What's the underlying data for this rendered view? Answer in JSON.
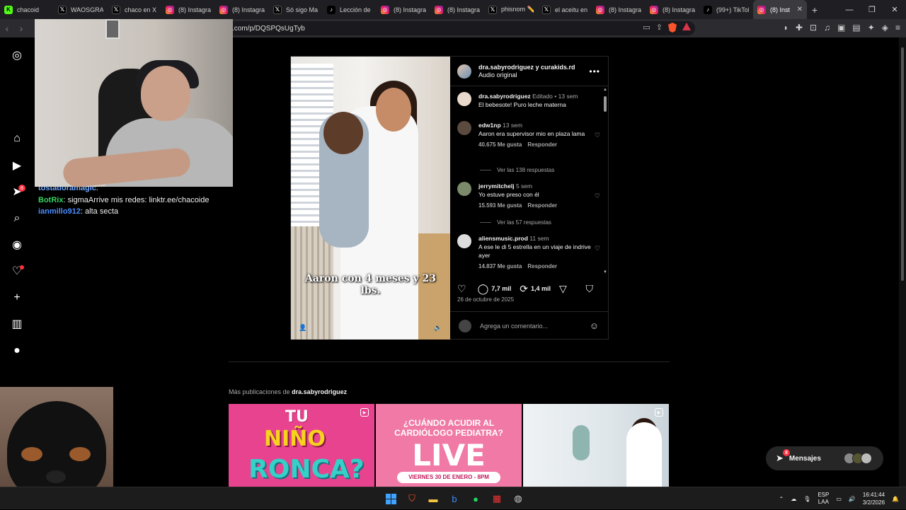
{
  "browser": {
    "tabs": [
      {
        "label": "chacoid",
        "icon": "kick-icon"
      },
      {
        "label": "WAOSGRAN",
        "icon": "x-icon"
      },
      {
        "label": "chaco en X",
        "icon": "x-icon"
      },
      {
        "label": "(8) Instagram",
        "icon": "instagram-icon"
      },
      {
        "label": "(8) Instagram",
        "icon": "instagram-icon"
      },
      {
        "label": "Só sigo Ma",
        "icon": "x-icon"
      },
      {
        "label": "Lección de",
        "icon": "tiktok-icon"
      },
      {
        "label": "(8) Instagram",
        "icon": "instagram-icon"
      },
      {
        "label": "(8) Instagram",
        "icon": "instagram-icon"
      },
      {
        "label": "phisnom ✏️",
        "icon": "x-icon"
      },
      {
        "label": "el aceitu en",
        "icon": "x-icon"
      },
      {
        "label": "(8) Instagram",
        "icon": "instagram-icon"
      },
      {
        "label": "(8) Instagram",
        "icon": "instagram-icon"
      },
      {
        "label": "(99+) TikTok",
        "icon": "tiktok-icon"
      }
    ],
    "active_tab": "(8) Inst",
    "url": ".com/p/DQSPQsUgTyb"
  },
  "chat": {
    "lines": [
      {
        "user": "tostadoramagic",
        "text": ""
      },
      {
        "user": "BotRix",
        "text": "sigmaArrive mis redes: linktr.ee/chacoide"
      },
      {
        "user": "ianmillo912",
        "text": "alta secta"
      }
    ]
  },
  "rail": {
    "notifications_badge": "8"
  },
  "post": {
    "header_names": "dra.sabyrodriguez y curakids.rd",
    "audio": "Audio original",
    "caption_overlay": "Aaron con 4 meses y 23 lbs.",
    "comments": [
      {
        "user": "dra.sabyrodriguez",
        "edited": "Editado",
        "time": "13 sem",
        "text": "El bebesote! Puro leche materna",
        "likes": "",
        "reply": ""
      },
      {
        "user": "edw1np",
        "time": "13 sem",
        "text": "Aaron era supervisor mio en plaza lama",
        "likes": "40.675 Me gusta",
        "reply": "Responder",
        "replies": "Ver las 138 respuestas"
      },
      {
        "user": "jerrymitchelj",
        "time": "5 sem",
        "text": "Yo estuve preso con él",
        "likes": "15.593 Me gusta",
        "reply": "Responder",
        "replies": "Ver las 57 respuestas"
      },
      {
        "user": "aliensmusic.prod",
        "time": "11 sem",
        "text": "A ese le di 5 estrella en un viaje de indrive ayer",
        "likes": "14.837 Me gusta",
        "reply": "Responder"
      }
    ],
    "comment_count": "7,7 mil",
    "share_count": "1,4 mil",
    "date": "26 de octubre de 2025",
    "add_comment_placeholder": "Agrega un comentario..."
  },
  "more_posts": {
    "prefix": "Más publicaciones de",
    "user": "dra.sabyrodriguez",
    "thumbs": [
      {
        "lines": [
          "TU",
          "NIÑO",
          "RONCA?"
        ]
      },
      {
        "lines": [
          "¿CUÁNDO ACUDIR AL CARDIÓLOGO PEDIATRA?",
          "LIVE",
          "VIERNES 30 DE ENERO - 8PM"
        ]
      },
      {
        "lines": []
      }
    ]
  },
  "messages": {
    "label": "Mensajes",
    "badge": "8"
  },
  "taskbar": {
    "lang_top": "ESP",
    "lang_bottom": "LAA",
    "time": "16:41:44",
    "date": "3/2/2026"
  }
}
